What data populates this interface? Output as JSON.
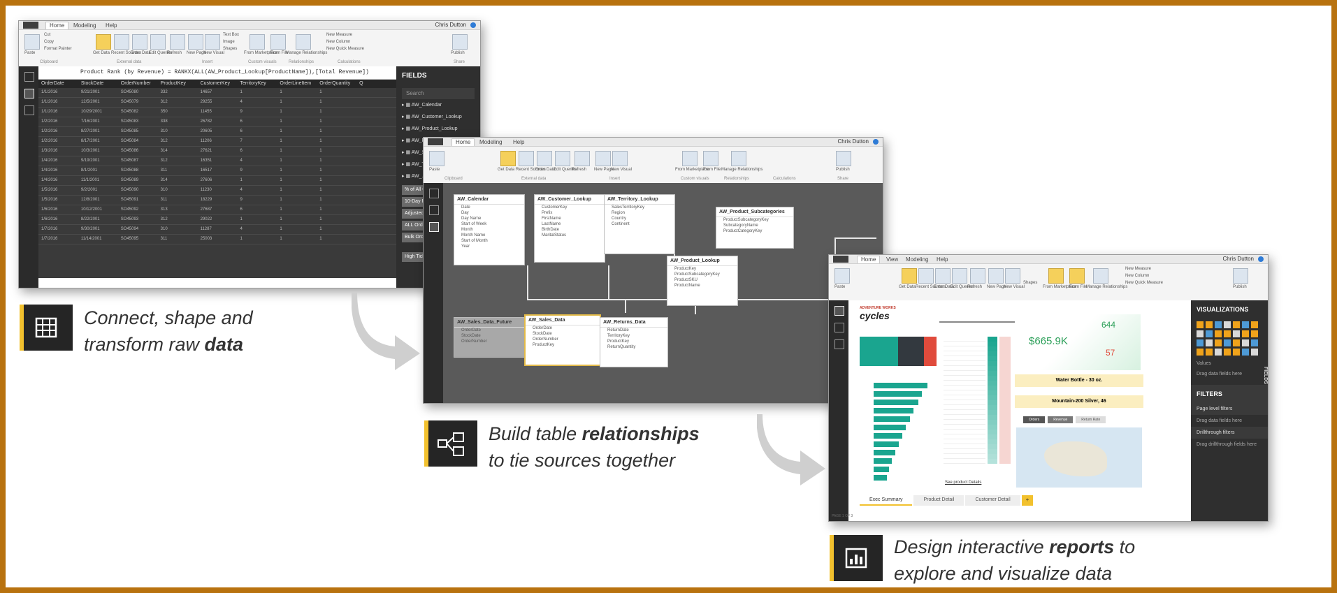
{
  "window1": {
    "tabs": [
      "Home",
      "Modeling",
      "Help"
    ],
    "user": "Chris Dutton",
    "ribbon_buttons": [
      "Paste",
      "Get Data",
      "Recent Sources",
      "Enter Data",
      "Edit Queries",
      "Refresh",
      "New Page",
      "New Visual",
      "From Marketplace",
      "From File",
      "Manage Relationships",
      "Publish"
    ],
    "clipboard": [
      "Cut",
      "Copy",
      "Format Painter"
    ],
    "insert_small": [
      "Text Box",
      "Image",
      "Shapes"
    ],
    "calc_small": [
      "New Measure",
      "New Column",
      "New Quick Measure"
    ],
    "groups": [
      "Clipboard",
      "External data",
      "Insert",
      "Custom visuals",
      "Relationships",
      "Calculations",
      "Share"
    ],
    "formula": "Product Rank (by Revenue) = RANKX(ALL(AW_Product_Lookup[ProductName]),[Total Revenue])",
    "columns": [
      "OrderDate",
      "StockDate",
      "OrderNumber",
      "ProductKey",
      "CustomerKey",
      "TerritoryKey",
      "OrderLineItem",
      "OrderQuantity",
      "Q"
    ],
    "rows": [
      [
        "1/1/2016",
        "9/21/2001",
        "SO45080",
        "332",
        "14657",
        "1",
        "1",
        "1"
      ],
      [
        "1/1/2016",
        "12/5/2001",
        "SO45079",
        "312",
        "29255",
        "4",
        "1",
        "1"
      ],
      [
        "1/1/2016",
        "10/29/2001",
        "SO45082",
        "350",
        "11455",
        "9",
        "1",
        "1"
      ],
      [
        "1/2/2016",
        "7/16/2001",
        "SO45083",
        "338",
        "26782",
        "6",
        "1",
        "1"
      ],
      [
        "1/2/2016",
        "8/27/2001",
        "SO45085",
        "310",
        "20605",
        "6",
        "1",
        "1"
      ],
      [
        "1/2/2016",
        "8/17/2001",
        "SO45084",
        "312",
        "11206",
        "7",
        "1",
        "1"
      ],
      [
        "1/3/2016",
        "10/3/2001",
        "SO45086",
        "314",
        "27621",
        "6",
        "1",
        "1"
      ],
      [
        "1/4/2016",
        "9/19/2001",
        "SO45087",
        "312",
        "16351",
        "4",
        "1",
        "1"
      ],
      [
        "1/4/2016",
        "8/1/2001",
        "SO45088",
        "311",
        "16517",
        "9",
        "1",
        "1"
      ],
      [
        "1/4/2016",
        "11/1/2001",
        "SO45089",
        "314",
        "27606",
        "1",
        "1",
        "1"
      ],
      [
        "1/5/2016",
        "9/2/2001",
        "SO45090",
        "310",
        "11230",
        "4",
        "1",
        "1"
      ],
      [
        "1/5/2016",
        "12/8/2001",
        "SO45091",
        "311",
        "18229",
        "9",
        "1",
        "1"
      ],
      [
        "1/6/2016",
        "10/12/2001",
        "SO45092",
        "313",
        "27687",
        "6",
        "1",
        "1"
      ],
      [
        "1/6/2016",
        "8/22/2001",
        "SO45093",
        "312",
        "29022",
        "1",
        "1",
        "1"
      ],
      [
        "1/7/2016",
        "9/30/2001",
        "SO45094",
        "310",
        "11287",
        "4",
        "1",
        "1"
      ],
      [
        "1/7/2016",
        "11/14/2001",
        "SO45095",
        "311",
        "25003",
        "1",
        "1",
        "1"
      ]
    ],
    "fields_title": "FIELDS",
    "search_placeholder": "Search",
    "field_items": [
      "AW_Calendar",
      "AW_Customer_Lookup",
      "AW_Product_Lookup",
      "AW_Returns_Data",
      "AW_Sales_Data",
      "AW_Territory_Lookup",
      "AW_..."
    ],
    "measures": [
      "% of All Orders",
      "10-Day Rolling Revenue",
      "Adjusted Price",
      "ALL Orders",
      "Bulk Orders"
    ],
    "bottom_measure": "High Ticket Orders"
  },
  "window2": {
    "tabs": [
      "Home",
      "Modeling",
      "Help"
    ],
    "user": "Chris Dutton",
    "ribbon_buttons": [
      "Paste",
      "Get Data",
      "Recent Sources",
      "Enter Data",
      "Edit Queries",
      "Refresh",
      "New Page",
      "New Visual",
      "From Marketplace",
      "From File",
      "Manage Relationships",
      "Publish"
    ],
    "groups": [
      "Clipboard",
      "External data",
      "Insert",
      "Custom visuals",
      "Relationships",
      "Calculations",
      "Share"
    ],
    "tables": [
      {
        "title": "AW_Calendar",
        "fields": [
          "Date",
          "Day",
          "Day Name",
          "Start of Week",
          "Month",
          "Month Name",
          "Start of Month",
          "Year"
        ]
      },
      {
        "title": "AW_Customer_Lookup",
        "fields": [
          "CustomerKey",
          "Prefix",
          "FirstName",
          "LastName",
          "BirthDate",
          "MaritalStatus"
        ]
      },
      {
        "title": "AW_Territory_Lookup",
        "fields": [
          "SalesTerritoryKey",
          "Region",
          "Country",
          "Continent"
        ]
      },
      {
        "title": "AW_Product_Subcategories",
        "fields": [
          "ProductSubcategoryKey",
          "SubcategoryName",
          "ProductCategoryKey"
        ]
      },
      {
        "title": "AW_Product_Lookup",
        "fields": [
          "ProductKey",
          "ProductSubcategoryKey",
          "ProductSKU",
          "ProductName"
        ]
      },
      {
        "title": "AW_Sales_Data_Future",
        "fields": [
          "OrderDate",
          "StockDate",
          "OrderNumber"
        ]
      },
      {
        "title": "AW_Sales_Data",
        "fields": [
          "OrderDate",
          "StockDate",
          "OrderNumber",
          "ProductKey"
        ]
      },
      {
        "title": "AW_Returns_Data",
        "fields": [
          "ReturnDate",
          "TerritoryKey",
          "ProductKey",
          "ReturnQuantity"
        ]
      }
    ]
  },
  "window3": {
    "tabs": [
      "Home",
      "View",
      "Modeling",
      "Help"
    ],
    "user": "Chris Dutton",
    "ribbon_buttons": [
      "Paste",
      "Get Data",
      "Recent Sources",
      "Enter Data",
      "Edit Queries",
      "Refresh",
      "New Page",
      "New Visual",
      "Shapes",
      "From Marketplace",
      "From File",
      "Manage Relationships",
      "Publish"
    ],
    "calc_small": [
      "New Measure",
      "New Column",
      "New Quick Measure"
    ],
    "logo_line1": "ADVENTURE WORKS",
    "logo_line2": "cycles",
    "kpi_revenue": "$665.9K",
    "kpi_orders": "644",
    "kpi_returns": "57",
    "top_product": "Water Bottle - 30 oz.",
    "top_bike": "Mountain-200 Silver, 46",
    "detail_link": "See product Details",
    "map_buttons": [
      "Orders",
      "Revenue",
      "Return Rate"
    ],
    "page_tabs": [
      "Exec Summary",
      "Product Detail",
      "Customer Detail"
    ],
    "add_page": "+",
    "page_status": "PAGE 1 OF 3",
    "vis_title": "VISUALIZATIONS",
    "values_label": "Values",
    "drag_here": "Drag data fields here",
    "filters_title": "FILTERS",
    "filter_items": [
      "Page level filters",
      "Drag data fields here",
      "Drillthrough filters",
      "Drag drillthrough fields here"
    ],
    "fields_side": "FIELDS"
  },
  "captions": {
    "c1_pre": "Connect, shape and",
    "c1_line2": "transform raw ",
    "c1_bold": "data",
    "c2_line1": "Build table ",
    "c2_bold": "relationships",
    "c2_line2": "to tie sources together",
    "c3_line1": "Design interactive ",
    "c3_bold": "reports",
    "c3_line1b": " to",
    "c3_line2": "explore and visualize data"
  },
  "colors": {
    "accent": "#f2c12e",
    "frame": "#b8720f",
    "teal": "#1aa58f",
    "red": "#e04b3c",
    "kpi_green": "#3ab06a"
  }
}
